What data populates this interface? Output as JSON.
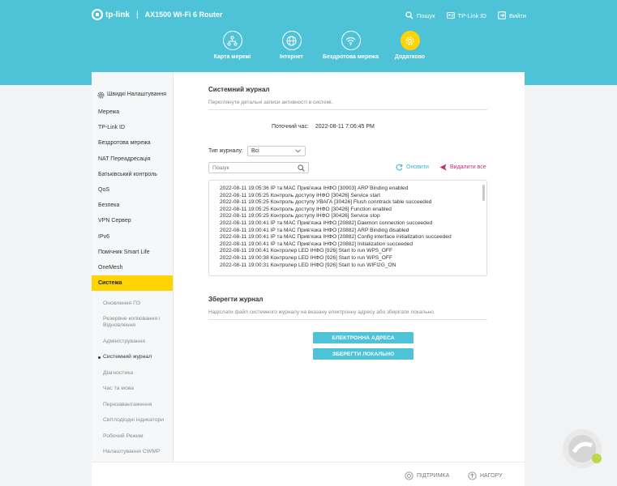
{
  "header": {
    "brand": "tp-link",
    "separator": "|",
    "model": "AX1500 Wi-Fi 6 Router",
    "links": [
      {
        "label": "Пошук",
        "icon": "search-icon"
      },
      {
        "label": "TP-Link ID",
        "icon": "id-icon"
      },
      {
        "label": "Вийти",
        "icon": "logout-icon"
      }
    ]
  },
  "nav": [
    {
      "label": "Карта мережі",
      "icon": "network-map-icon",
      "active": false
    },
    {
      "label": "Інтернет",
      "icon": "globe-icon",
      "active": false
    },
    {
      "label": "Бездротова мережа",
      "icon": "wifi-icon",
      "active": false
    },
    {
      "label": "Додатково",
      "icon": "gear-icon",
      "active": true
    }
  ],
  "sidebar": {
    "home": "Швидкі Налаштування",
    "items": [
      "Мережа",
      "TP-Link ID",
      "Бездротова мережа",
      "NAT Переадресація",
      "Батьківський контроль",
      "QoS",
      "Безпека",
      "VPN Сервер",
      "IPv6",
      "Помічник Smart Life",
      "OneMesh",
      "Система"
    ],
    "active_item": "Система",
    "subitems": [
      "Оновлення ПЗ",
      "Резервне копіювання і Відновлення",
      "Адміністрування",
      "Системний журнал",
      "Діагностика",
      "Час та мова",
      "Перезавантаження",
      "Світлодіодні індикатори",
      "Робочий Режим",
      "Налаштування CWMP"
    ],
    "current_subitem": "Системний журнал"
  },
  "syslog": {
    "title": "Системний журнал",
    "description": "Переглянути детальні записи активності в системі.",
    "time_label": "Поточний час:",
    "time_value": "2022-08-11 7:06:45 PM",
    "type_label": "Тип журналу:",
    "type_value": "Всі",
    "search_placeholder": "Пошук",
    "refresh_label": "Оновити",
    "delete_all_label": "Видалити все",
    "entries": [
      "2022-08-11 19:05:36 IP та MAC Прив'язка ІНФО [30903] ARP Binding enabled",
      "2022-08-11 19:05:25 Контроль доступу ІНФО [30426] Service start",
      "2022-08-11 19:05:25 Контроль доступу УВАГА [30426] Flush conntrack table succeeded",
      "2022-08-11 19:05:25 Контроль доступу ІНФО [30426] Function enabled",
      "2022-08-11 19:05:25 Контроль доступу ІНФО [30426] Service stop",
      "2022-08-11 19:00:41 IP та MAC Прив'язка ІНФО [20882] Daemon connection succeeded",
      "2022-08-11 19:00:41 IP та MAC Прив'язка ІНФО [20882] ARP Binding disabled",
      "2022-08-11 19:00:41 IP та MAC Прив'язка ІНФО [20882] Config interface initialization succeeded",
      "2022-08-11 19:00:41 IP та MAC Прив'язка ІНФО [20882] Initialization succeeded",
      "2022-08-11 19:00:41 Контролер LED ІНФО [926] Start to run WPS_OFF",
      "2022-08-11 19:00:38 Контролер LED ІНФО [926] Start to run WPS_OFF",
      "2022-08-11 19:00:31 Контролер LED ІНФО [926] Start to run WIFI2G_ON"
    ]
  },
  "save_log": {
    "title": "Зберегти журнал",
    "description": "Надіслати файл системного журналу на вказану електронну адресу або зберігати локально.",
    "email_button": "ЕЛЕКТРОННА АДРЕСА",
    "save_button": "ЗБЕРЕГТИ ЛОКАЛЬНО"
  },
  "footer": {
    "support": "ПІДТРИМКА",
    "back_to_top": "НАГОРУ"
  },
  "colors": {
    "header_bg": "#4ec3d8",
    "active_nav": "#ffd400",
    "active_sidebar": "#ffd400",
    "button_bg": "#4ec3d8",
    "refresh": "#3ab5cc",
    "delete_all": "#c0307a"
  }
}
